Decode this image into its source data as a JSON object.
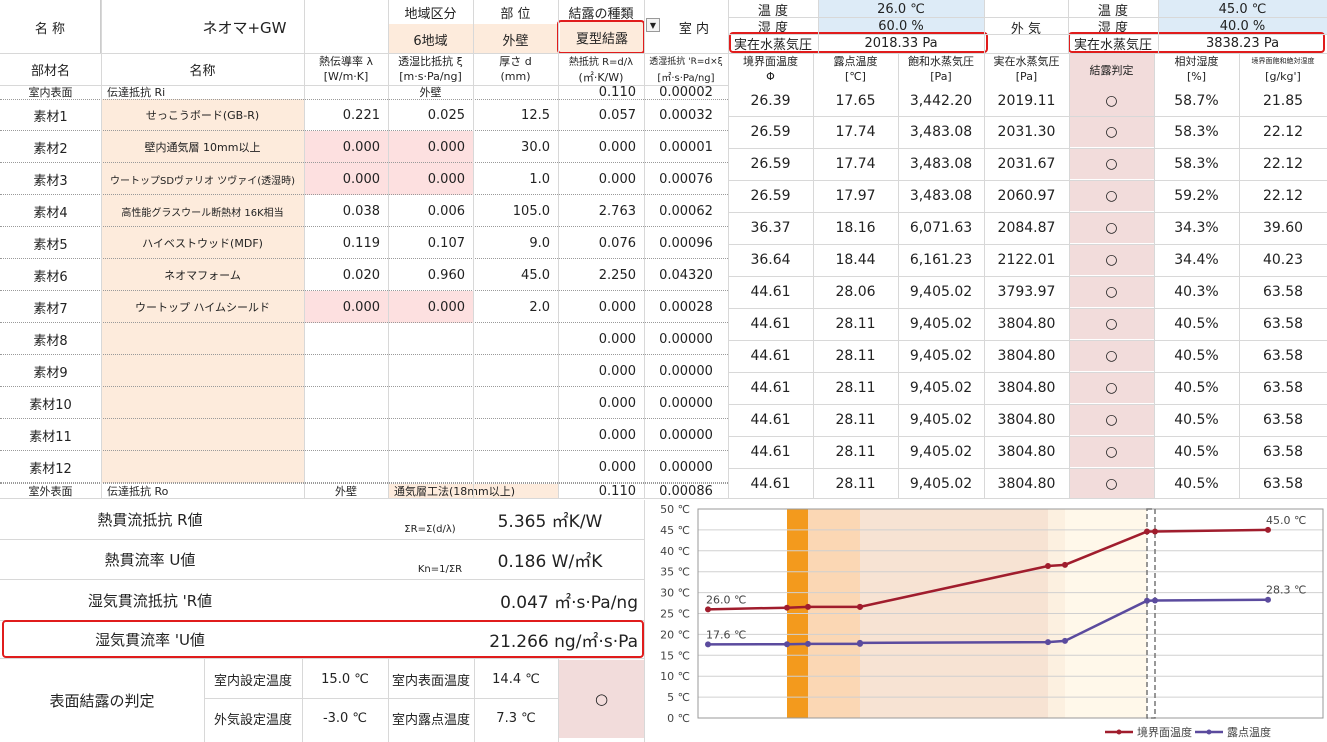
{
  "header": {
    "name_label": "名 称",
    "name_value": "ネオマ+GW",
    "region_label": "地域区分",
    "region_value": "6地域",
    "part_label": "部 位",
    "part_value": "外壁",
    "cond_type_label": "結露の種類",
    "cond_type_value": "夏型結露",
    "indoor_label": "室 内",
    "outdoor_label": "外 気",
    "in_temp_label": "温 度",
    "in_temp_value": "26.0 ℃",
    "in_hum_label": "湿 度",
    "in_hum_value": "60.0 %",
    "in_vp_label": "実在水蒸気圧",
    "in_vp_value": "2018.33 Pa",
    "out_temp_label": "温 度",
    "out_temp_value": "45.0 ℃",
    "out_hum_label": "湿 度",
    "out_hum_value": "40.0 %",
    "out_vp_label": "実在水蒸気圧",
    "out_vp_value": "3838.23 Pa"
  },
  "columns": {
    "member": "部材名",
    "name": "名称",
    "lambda": [
      "熱伝導率 λ",
      "[W/m·K]"
    ],
    "xi": [
      "透湿比抵抗 ξ",
      "[m·s·Pa/ng]"
    ],
    "d": [
      "厚さ d",
      "(mm)"
    ],
    "R": [
      "熱抵抗 R=d/λ",
      "(㎡·K/W)"
    ],
    "Rp": [
      "透湿抵抗 'R=d×ξ",
      "[㎡·s·Pa/ng]"
    ],
    "theta": [
      "境界面温度",
      "Φ"
    ],
    "dew": [
      "露点温度",
      "[℃]"
    ],
    "sat": [
      "飽和水蒸気圧",
      "[Pa]"
    ],
    "act": [
      "実在水蒸気圧",
      "[Pa]"
    ],
    "judge": "結露判定",
    "rh": [
      "相対湿度",
      "[%]"
    ],
    "abs": [
      "境界面飽和絶対湿度",
      "[g/kg']"
    ]
  },
  "inner_surface": {
    "member": "室内表面",
    "name": "伝達抵抗 Ri",
    "xi": "外壁",
    "R": "0.110",
    "Rp": "0.00002"
  },
  "outer_surface": {
    "member": "室外表面",
    "name": "伝達抵抗 Ro",
    "lambda": "外壁",
    "xi": "通気層工法(18mm以上)",
    "R": "0.110",
    "Rp": "0.00086"
  },
  "materials": [
    {
      "member": "素材1",
      "name": "せっこうボード(GB-R)",
      "lambda": "0.221",
      "xi": "0.025",
      "d": "12.5",
      "R": "0.057",
      "Rp": "0.00032"
    },
    {
      "member": "素材2",
      "name": "壁内通気層 10mm以上",
      "lambda": "0.000",
      "xi": "0.000",
      "d": "30.0",
      "R": "0.000",
      "Rp": "0.00001"
    },
    {
      "member": "素材3",
      "name": "ウートップSDヴァリオ ツヴァイ(透湿時)",
      "lambda": "0.000",
      "xi": "0.000",
      "d": "1.0",
      "R": "0.000",
      "Rp": "0.00076"
    },
    {
      "member": "素材4",
      "name": "高性能グラスウール断熱材 16K相当",
      "lambda": "0.038",
      "xi": "0.006",
      "d": "105.0",
      "R": "2.763",
      "Rp": "0.00062"
    },
    {
      "member": "素材5",
      "name": "ハイベストウッド(MDF)",
      "lambda": "0.119",
      "xi": "0.107",
      "d": "9.0",
      "R": "0.076",
      "Rp": "0.00096"
    },
    {
      "member": "素材6",
      "name": "ネオマフォーム",
      "lambda": "0.020",
      "xi": "0.960",
      "d": "45.0",
      "R": "2.250",
      "Rp": "0.04320"
    },
    {
      "member": "素材7",
      "name": "ウートップ ハイムシールド",
      "lambda": "0.000",
      "xi": "0.000",
      "d": "2.0",
      "R": "0.000",
      "Rp": "0.00028"
    },
    {
      "member": "素材8",
      "name": "",
      "lambda": "",
      "xi": "",
      "d": "",
      "R": "0.000",
      "Rp": "0.00000"
    },
    {
      "member": "素材9",
      "name": "",
      "lambda": "",
      "xi": "",
      "d": "",
      "R": "0.000",
      "Rp": "0.00000"
    },
    {
      "member": "素材10",
      "name": "",
      "lambda": "",
      "xi": "",
      "d": "",
      "R": "0.000",
      "Rp": "0.00000"
    },
    {
      "member": "素材11",
      "name": "",
      "lambda": "",
      "xi": "",
      "d": "",
      "R": "0.000",
      "Rp": "0.00000"
    },
    {
      "member": "素材12",
      "name": "",
      "lambda": "",
      "xi": "",
      "d": "",
      "R": "0.000",
      "Rp": "0.00000"
    }
  ],
  "boundaries": [
    {
      "theta": "26.39",
      "dew": "17.65",
      "sat": "3,442.20",
      "act": "2019.11",
      "judge": "○",
      "rh": "58.7%",
      "abs": "21.85"
    },
    {
      "theta": "26.59",
      "dew": "17.74",
      "sat": "3,483.08",
      "act": "2031.30",
      "judge": "○",
      "rh": "58.3%",
      "abs": "22.12"
    },
    {
      "theta": "26.59",
      "dew": "17.74",
      "sat": "3,483.08",
      "act": "2031.67",
      "judge": "○",
      "rh": "58.3%",
      "abs": "22.12"
    },
    {
      "theta": "26.59",
      "dew": "17.97",
      "sat": "3,483.08",
      "act": "2060.97",
      "judge": "○",
      "rh": "59.2%",
      "abs": "22.12"
    },
    {
      "theta": "36.37",
      "dew": "18.16",
      "sat": "6,071.63",
      "act": "2084.87",
      "judge": "○",
      "rh": "34.3%",
      "abs": "39.60"
    },
    {
      "theta": "36.64",
      "dew": "18.44",
      "sat": "6,161.23",
      "act": "2122.01",
      "judge": "○",
      "rh": "34.4%",
      "abs": "40.23"
    },
    {
      "theta": "44.61",
      "dew": "28.06",
      "sat": "9,405.02",
      "act": "3793.97",
      "judge": "○",
      "rh": "40.3%",
      "abs": "63.58"
    },
    {
      "theta": "44.61",
      "dew": "28.11",
      "sat": "9,405.02",
      "act": "3804.80",
      "judge": "○",
      "rh": "40.5%",
      "abs": "63.58"
    },
    {
      "theta": "44.61",
      "dew": "28.11",
      "sat": "9,405.02",
      "act": "3804.80",
      "judge": "○",
      "rh": "40.5%",
      "abs": "63.58"
    },
    {
      "theta": "44.61",
      "dew": "28.11",
      "sat": "9,405.02",
      "act": "3804.80",
      "judge": "○",
      "rh": "40.5%",
      "abs": "63.58"
    },
    {
      "theta": "44.61",
      "dew": "28.11",
      "sat": "9,405.02",
      "act": "3804.80",
      "judge": "○",
      "rh": "40.5%",
      "abs": "63.58"
    },
    {
      "theta": "44.61",
      "dew": "28.11",
      "sat": "9,405.02",
      "act": "3804.80",
      "judge": "○",
      "rh": "40.5%",
      "abs": "63.58"
    },
    {
      "theta": "44.61",
      "dew": "28.11",
      "sat": "9,405.02",
      "act": "3804.80",
      "judge": "○",
      "rh": "40.5%",
      "abs": "63.58"
    }
  ],
  "summary": {
    "R_label": "熱貫流抵抗 R値",
    "R_formula": "ΣR=Σ(d/λ)",
    "R_value": "5.365 ㎡K/W",
    "U_label": "熱貫流率 U値",
    "U_formula": "Kn=1/ΣR",
    "U_value": "0.186 W/㎡K",
    "Rp_label": "湿気貫流抵抗 'R値",
    "Rp_value": "0.047 ㎡·s·Pa/ng",
    "Up_label": "湿気貫流率 'U値",
    "Up_value": "21.266 ng/㎡·s·Pa"
  },
  "surface_check": {
    "title": "表面結露の判定",
    "in_set_label": "室内設定温度",
    "in_set_value": "15.0 ℃",
    "in_surf_label": "室内表面温度",
    "in_surf_value": "14.4 ℃",
    "out_set_label": "外気設定温度",
    "out_set_value": "-3.0 ℃",
    "dew_label": "室内露点温度",
    "dew_value": "7.3 ℃",
    "result": "○"
  },
  "chart_data": {
    "type": "line",
    "y_ticks": [
      "0 ℃",
      "5 ℃",
      "10 ℃",
      "15 ℃",
      "20 ℃",
      "25 ℃",
      "30 ℃",
      "35 ℃",
      "40 ℃",
      "45 ℃",
      "50 ℃"
    ],
    "ylim": [
      0,
      50
    ],
    "series": [
      {
        "name": "境界面温度",
        "color": "#a01d2d",
        "values": [
          26.0,
          26.39,
          26.59,
          26.59,
          26.59,
          36.37,
          36.64,
          44.61,
          44.61,
          45.0
        ]
      },
      {
        "name": "露点温度",
        "color": "#5b4b9e",
        "values": [
          17.6,
          17.65,
          17.74,
          17.74,
          17.97,
          18.16,
          18.44,
          28.06,
          28.11,
          28.3
        ]
      }
    ],
    "labels": [
      {
        "text": "26.0 ℃",
        "series": 0,
        "point": 0
      },
      {
        "text": "45.0 ℃",
        "series": 0,
        "point": 9
      },
      {
        "text": "17.6 ℃",
        "series": 1,
        "point": 0
      },
      {
        "text": "28.3 ℃",
        "series": 1,
        "point": 9
      }
    ],
    "layers": [
      {
        "color": "#f39a1d"
      },
      {
        "color": "#fbd7b4"
      },
      {
        "color": "#f7e3d3"
      },
      {
        "color": "#fcf0e0"
      },
      {
        "color": "#fff8ea"
      }
    ]
  }
}
